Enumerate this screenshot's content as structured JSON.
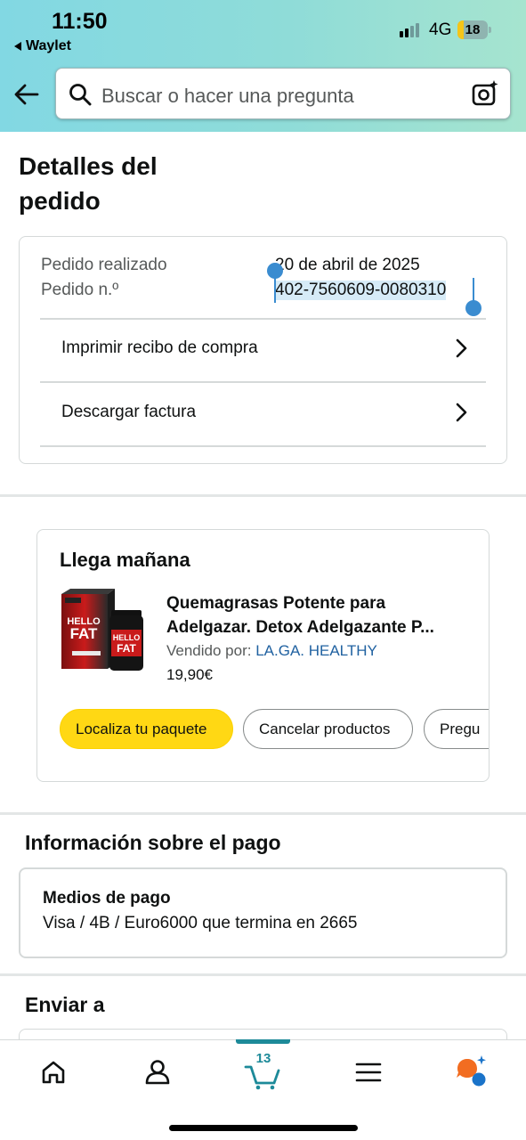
{
  "status_bar": {
    "time": "11:50",
    "back_app": "Waylet",
    "network": "4G",
    "battery": "18"
  },
  "search": {
    "placeholder": "Buscar o hacer una pregunta"
  },
  "page": {
    "title_line1": "Detalles del",
    "title_line2": "pedido"
  },
  "order": {
    "placed_label": "Pedido realizado",
    "placed_value": "20 de abril de 2025",
    "number_label": "Pedido n.º",
    "number_value": "402-7560609-0080310",
    "print_receipt": "Imprimir recibo de compra",
    "download_invoice": "Descargar factura"
  },
  "shipment": {
    "title": "Llega mañana",
    "product_title": "Quemagrasas Potente para Adelgazar. Detox Adelgazante P...",
    "sold_by_label": "Vendido por:",
    "seller": "LA.GA. HEALTHY",
    "price": "19,90€",
    "product_brand_text": "HELLO FAT",
    "buttons": {
      "track": "Localiza tu paquete",
      "cancel": "Cancelar productos",
      "ask": "Pregu"
    }
  },
  "payment": {
    "section_title": "Información sobre el pago",
    "method_title": "Medios de pago",
    "method_value": "Visa / 4B / Euro6000  que termina en 2665"
  },
  "shipping": {
    "section_title": "Enviar a"
  },
  "bottom_nav": {
    "cart_count": "13",
    "items": [
      "home-icon",
      "account-icon",
      "cart-icon",
      "menu-icon",
      "rufus-icon"
    ]
  },
  "colors": {
    "header_gradient_start": "#82d8e3",
    "header_gradient_end": "#a6e4cf",
    "primary_button": "#ffd814",
    "link": "#2162a1",
    "active_tab": "#1d8a99",
    "selection": "#3a8cd0"
  }
}
